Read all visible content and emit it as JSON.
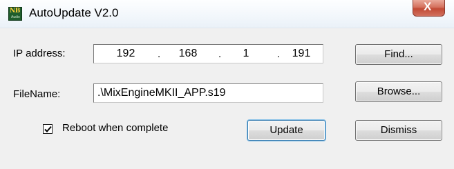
{
  "window": {
    "title": "AutoUpdate V2.0",
    "icon": "nb-app-icon",
    "icon_text": "NB",
    "icon_subtext": "Audio",
    "close_glyph": "X"
  },
  "form": {
    "ip_label": "IP address:",
    "ip_octets": [
      "192",
      "168",
      "1",
      "191"
    ],
    "ip_separator": ".",
    "filename_label": "FileName:",
    "filename_value": ".\\MixEngineMKII_APP.s19",
    "reboot_label": "Reboot when complete",
    "reboot_checked": true
  },
  "buttons": {
    "find": "Find...",
    "browse": "Browse...",
    "update": "Update",
    "dismiss": "Dismiss"
  },
  "colors": {
    "close_button": "#c9503b",
    "icon_background": "#1f5d2c",
    "dialog_background": "#f0f0f0"
  }
}
